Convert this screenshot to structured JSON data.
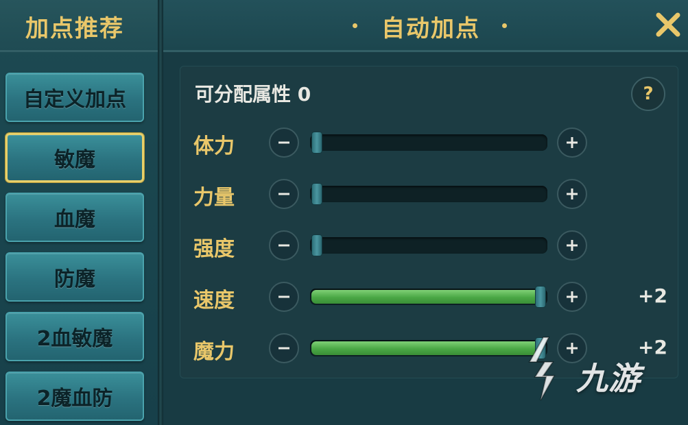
{
  "sidebar": {
    "title": "加点推荐",
    "presets": [
      {
        "label": "自定义加点",
        "selected": false
      },
      {
        "label": "敏魔",
        "selected": true
      },
      {
        "label": "血魔",
        "selected": false
      },
      {
        "label": "防魔",
        "selected": false
      },
      {
        "label": "2血敏魔",
        "selected": false
      },
      {
        "label": "2魔血防",
        "selected": false
      }
    ]
  },
  "header": {
    "title": "自动加点",
    "close_icon": "close-icon"
  },
  "panel": {
    "allocatable_label": "可分配属性 0",
    "help_label": "?",
    "stats": [
      {
        "name": "体力",
        "level": 0.0,
        "bonus": ""
      },
      {
        "name": "力量",
        "level": 0.0,
        "bonus": ""
      },
      {
        "name": "强度",
        "level": 0.0,
        "bonus": ""
      },
      {
        "name": "速度",
        "level": 1.0,
        "bonus": "+2"
      },
      {
        "name": "魔力",
        "level": 1.0,
        "bonus": "+2"
      }
    ]
  },
  "watermark": {
    "text": "九游"
  },
  "colors": {
    "accent_gold": "#e9c76a",
    "button_teal": "#2b7380",
    "fill_green": "#4aa745",
    "background": "#173a42"
  }
}
